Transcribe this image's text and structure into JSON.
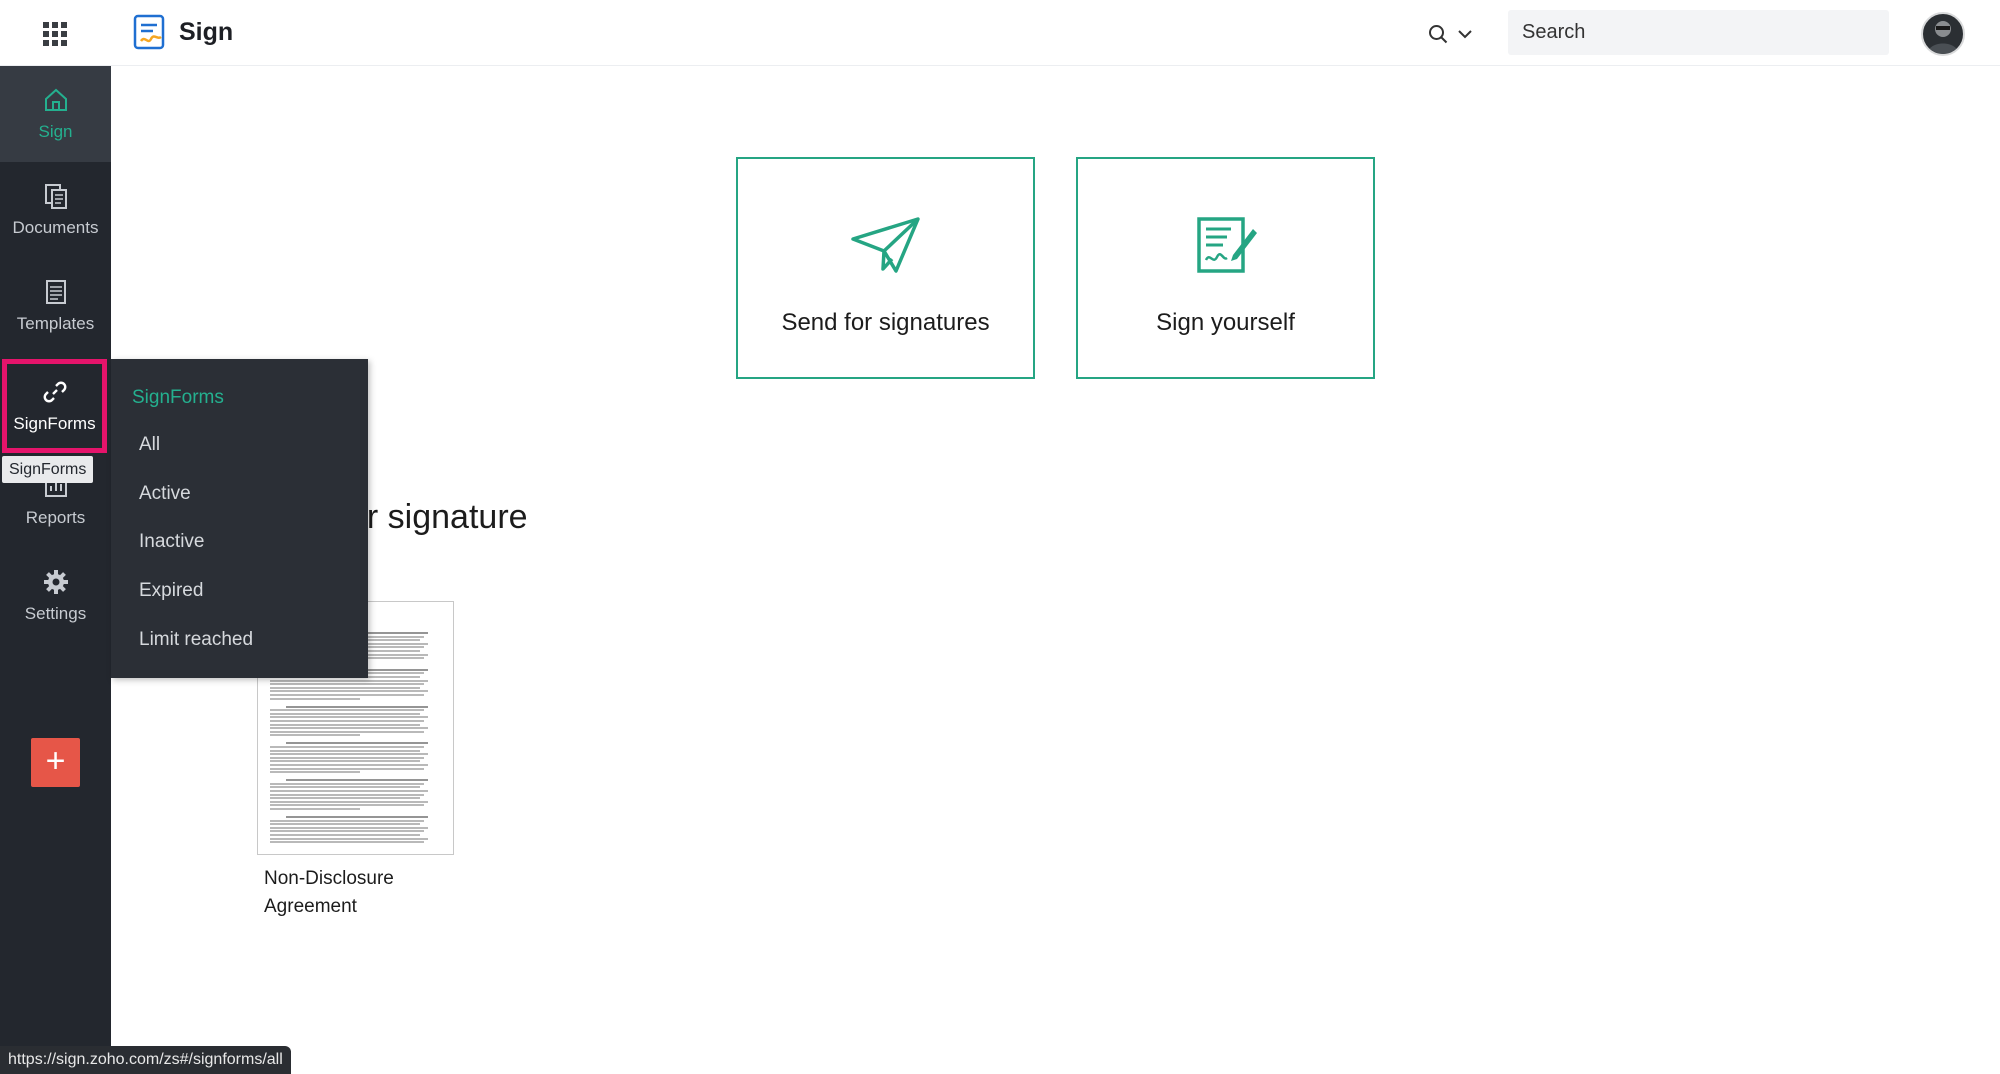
{
  "topbar": {
    "app_title": "Sign",
    "search_placeholder": "Search"
  },
  "sidebar": {
    "items": [
      {
        "key": "sign",
        "label": "Sign",
        "icon": "home-icon"
      },
      {
        "key": "documents",
        "label": "Documents",
        "icon": "documents-icon"
      },
      {
        "key": "templates",
        "label": "Templates",
        "icon": "templates-icon"
      },
      {
        "key": "signforms",
        "label": "SignForms",
        "icon": "link-icon"
      },
      {
        "key": "reports",
        "label": "Reports",
        "icon": "reports-icon"
      },
      {
        "key": "settings",
        "label": "Settings",
        "icon": "gear-icon"
      }
    ],
    "active": "Sign",
    "hovered": "SignForms",
    "tooltip": "SignForms",
    "add_button": "+"
  },
  "flyout": {
    "title": "SignForms",
    "items": [
      "All",
      "Active",
      "Inactive",
      "Expired",
      "Limit reached"
    ]
  },
  "main": {
    "cards": [
      {
        "label": "Send for signatures",
        "icon": "paper-plane-icon"
      },
      {
        "label": "Sign yourself",
        "icon": "sign-document-icon"
      }
    ],
    "section_heading": "ur signature",
    "documents": [
      {
        "name_line1": "Non-Disclosure",
        "name_line2": "Agreement"
      }
    ]
  },
  "status_bar": {
    "url": "https://sign.zoho.com/zs#/signforms/all"
  },
  "colors": {
    "accent": "#24b08f",
    "sidebar_bg": "#23272e",
    "highlight": "#e5146b",
    "add_button": "#e65648"
  }
}
